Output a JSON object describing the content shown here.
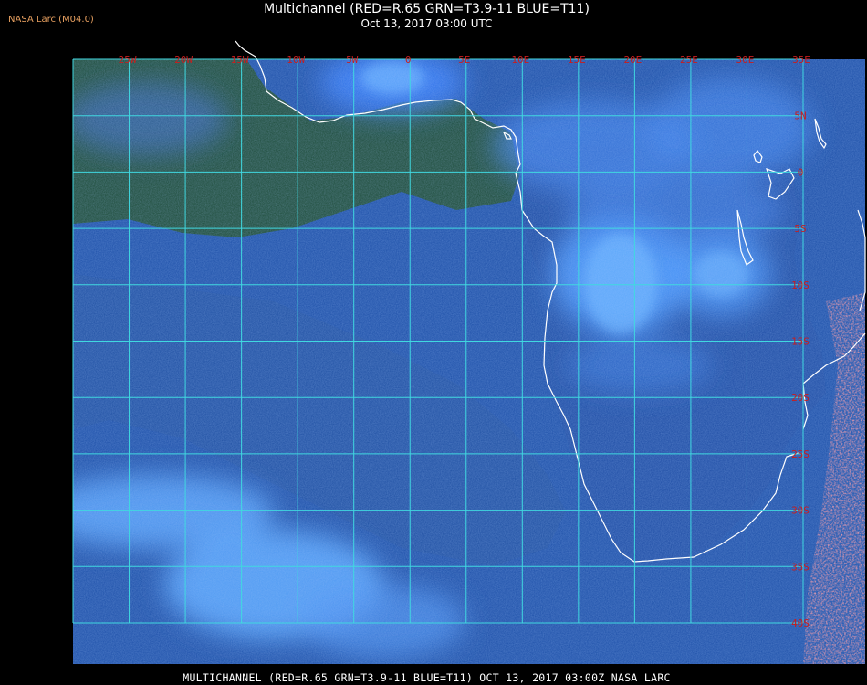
{
  "header": {
    "credit": "NASA Larc (M04.0)",
    "title": "Multichannel (RED=R.65 GRN=T3.9-11 BLUE=T11)",
    "datetime": "Oct 13, 2017 03:00 UTC"
  },
  "footer": {
    "caption": "MULTICHANNEL (RED=R.65 GRN=T3.9-11 BLUE=T11) OCT 13, 2017 03:00Z  NASA LARC"
  },
  "map": {
    "region": {
      "lon_min": -30,
      "lon_max": 35,
      "lat_min": -40,
      "lat_max": 10
    },
    "grid_step_degrees": 5,
    "longitude_labels": [
      "25W",
      "20W",
      "15W",
      "10W",
      "5W",
      "0",
      "5E",
      "10E",
      "15E",
      "20E",
      "25E",
      "30E",
      "35E"
    ],
    "latitude_labels": [
      "5N",
      "0",
      "5S",
      "10S",
      "15S",
      "20S",
      "25S",
      "30S",
      "35S",
      "40S"
    ],
    "colors": {
      "background": "#000000",
      "gridline": "#40d8e0",
      "label": "#c81e1e",
      "coastline": "#ffffff",
      "ocean": "#1e56b4",
      "land_vegetation": "#1e4a22",
      "cloud": "#3c8cff",
      "fire_hotspots": "#e65050"
    }
  }
}
